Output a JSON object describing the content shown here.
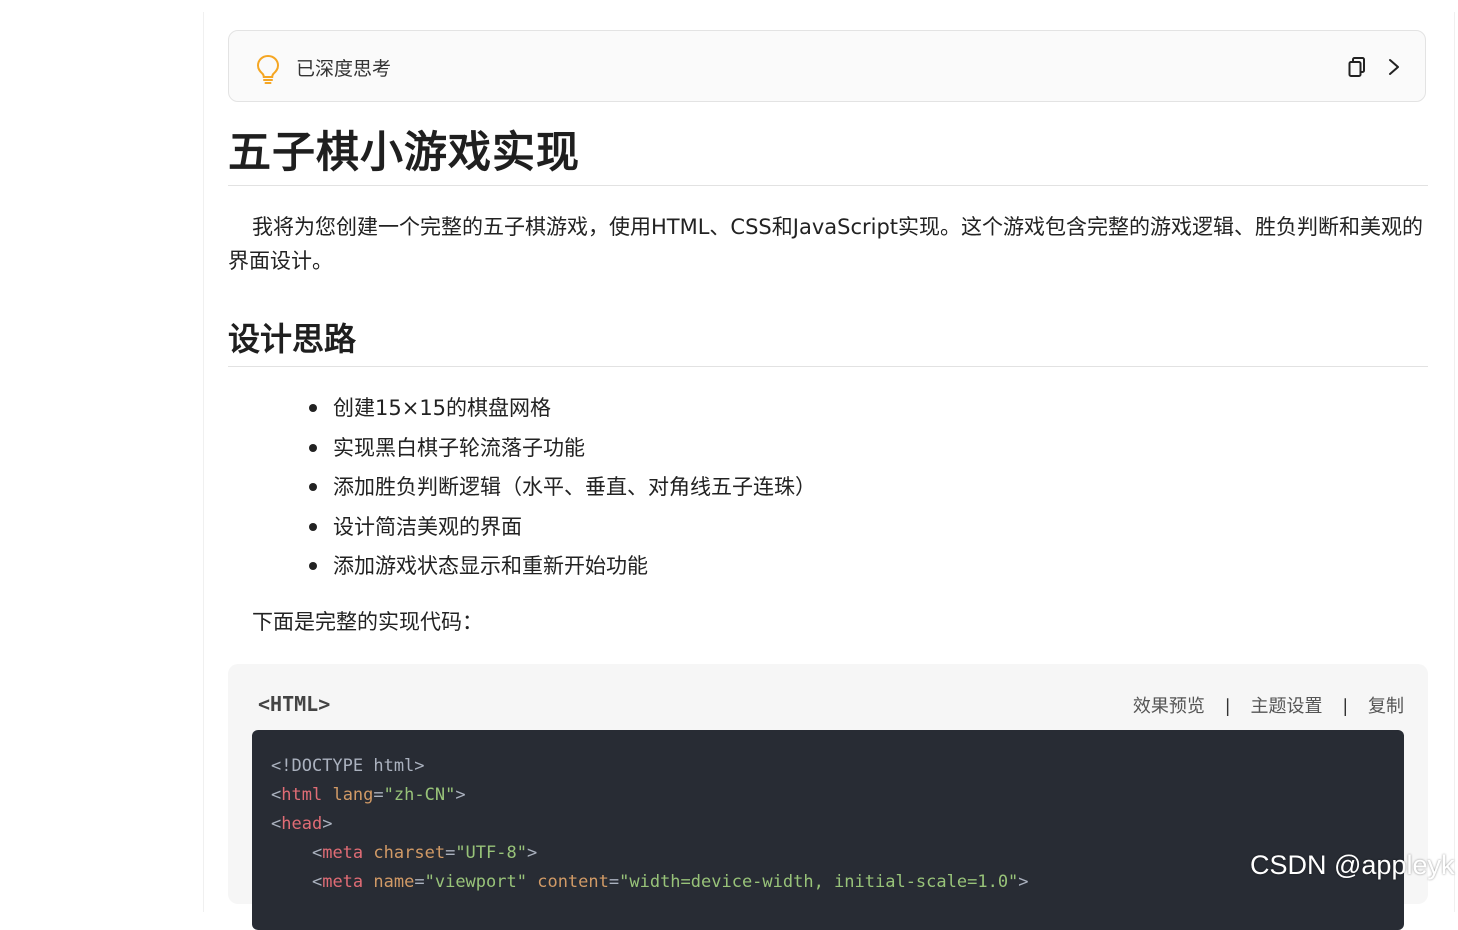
{
  "think": {
    "label": "已深度思考",
    "icon": "bulb-icon",
    "actions": [
      "copy-icon",
      "chevron-right-icon"
    ],
    "icon_color": "#f5a623"
  },
  "article": {
    "title": "五子棋小游戏实现",
    "intro": "我将为您创建一个完整的五子棋游戏，使用HTML、CSS和JavaScript实现。这个游戏包含完整的游戏逻辑、胜负判断和美观的界面设计。",
    "section_title": "设计思路",
    "points": [
      "创建15×15的棋盘网格",
      "实现黑白棋子轮流落子功能",
      "添加胜负判断逻辑（水平、垂直、对角线五子连珠）",
      "设计简洁美观的界面",
      "添加游戏状态显示和重新开始功能"
    ],
    "code_intro": "下面是完整的实现代码："
  },
  "code": {
    "language": "<HTML>",
    "actions": {
      "preview": "效果预览",
      "theme": "主题设置",
      "copy": "复制"
    },
    "separator": "|",
    "lines": {
      "l1": "<!DOCTYPE html>",
      "l2": {
        "open": "<",
        "tag": "html",
        "attr": "lang",
        "eq": "=",
        "val": "\"zh-CN\"",
        "close": ">"
      },
      "l3": {
        "open": "<",
        "tag": "head",
        "close": ">"
      },
      "l4": {
        "indent": "    ",
        "open": "<",
        "tag": "meta",
        "attr": "charset",
        "eq": "=",
        "val": "\"UTF-8\"",
        "close": ">"
      },
      "l5": {
        "indent": "    ",
        "open": "<",
        "tag": "meta",
        "attr1": "name",
        "eq1": "=",
        "val1": "\"viewport\"",
        "attr2": "content",
        "eq2": "=",
        "val2": "\"width=device-width, initial-scale=1.0\"",
        "close": ">"
      }
    },
    "theme_colors": {
      "bg": "#282c34",
      "tag": "#e06c75",
      "attr": "#d19a66",
      "string": "#98c379"
    }
  },
  "watermark": "CSDN @appleyk"
}
